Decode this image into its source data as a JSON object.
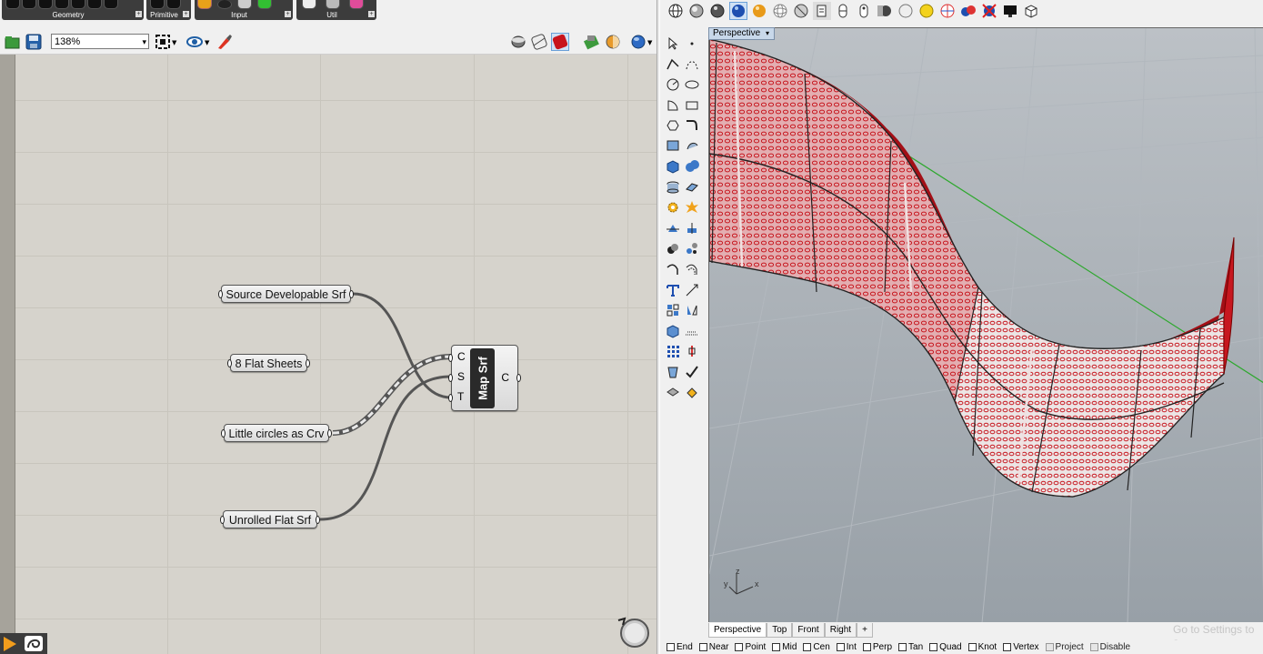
{
  "grasshopper": {
    "tab_groups": [
      {
        "label": "Geometry"
      },
      {
        "label": "Primitive"
      },
      {
        "label": "Input"
      },
      {
        "label": "Util"
      }
    ],
    "toolbar": {
      "zoom_value": "138%",
      "icons": [
        "open-file-icon",
        "save-file-icon",
        "zoom-extents-icon",
        "preview-eye-icon",
        "sketch-brush-icon",
        "shaded-preview-icon",
        "wireframe-preview-icon",
        "selected-preview-icon",
        "bake-icon",
        "material-icon",
        "sphere-preview-icon"
      ]
    },
    "components": {
      "source_param": "Source Developable Srf",
      "flat_sheets_param": "8 Flat Sheets",
      "circles_param": "Little circles as Crv",
      "unrolled_param": "Unrolled Flat Srf",
      "map_srf": {
        "title": "Map Srf",
        "inputs": [
          "C",
          "S",
          "T"
        ],
        "output": "C"
      }
    }
  },
  "rhino": {
    "toolbar_icons": [
      "globe-icon",
      "shaded-sphere-icon",
      "rendered-sphere-icon",
      "blue-sphere-icon",
      "gold-sphere-icon",
      "wire-sphere-icon",
      "ghosted-sphere-icon",
      "layer-icon",
      "capsule-icon",
      "capsule-outline-icon",
      "material-sphere-icon",
      "white-sphere-icon",
      "yellow-sphere-icon",
      "section-sphere-icon",
      "multi-sphere-icon",
      "no-sphere-icon",
      "display-icon",
      "box-icon"
    ],
    "viewport": {
      "label": "Perspective",
      "axis_labels": {
        "x": "x",
        "y": "y",
        "z": "z"
      }
    },
    "view_tabs": [
      "Perspective",
      "Top",
      "Front",
      "Right",
      "+"
    ],
    "watermark": "Go to Settings to a",
    "osnaps": [
      {
        "label": "End",
        "enabled": true
      },
      {
        "label": "Near",
        "enabled": true
      },
      {
        "label": "Point",
        "enabled": true
      },
      {
        "label": "Mid",
        "enabled": true
      },
      {
        "label": "Cen",
        "enabled": true
      },
      {
        "label": "Int",
        "enabled": true
      },
      {
        "label": "Perp",
        "enabled": true
      },
      {
        "label": "Tan",
        "enabled": true
      },
      {
        "label": "Quad",
        "enabled": true
      },
      {
        "label": "Knot",
        "enabled": true
      },
      {
        "label": "Vertex",
        "enabled": true
      },
      {
        "label": "Project",
        "enabled": false
      },
      {
        "label": "Disable",
        "enabled": false
      }
    ]
  },
  "colors": {
    "surface_red": "#c7171f",
    "surface_fill": "#d98f93",
    "canvas": "#d6d3cc",
    "viewport_bg": "#9fa6ad",
    "axis_green": "#2ea82e"
  }
}
